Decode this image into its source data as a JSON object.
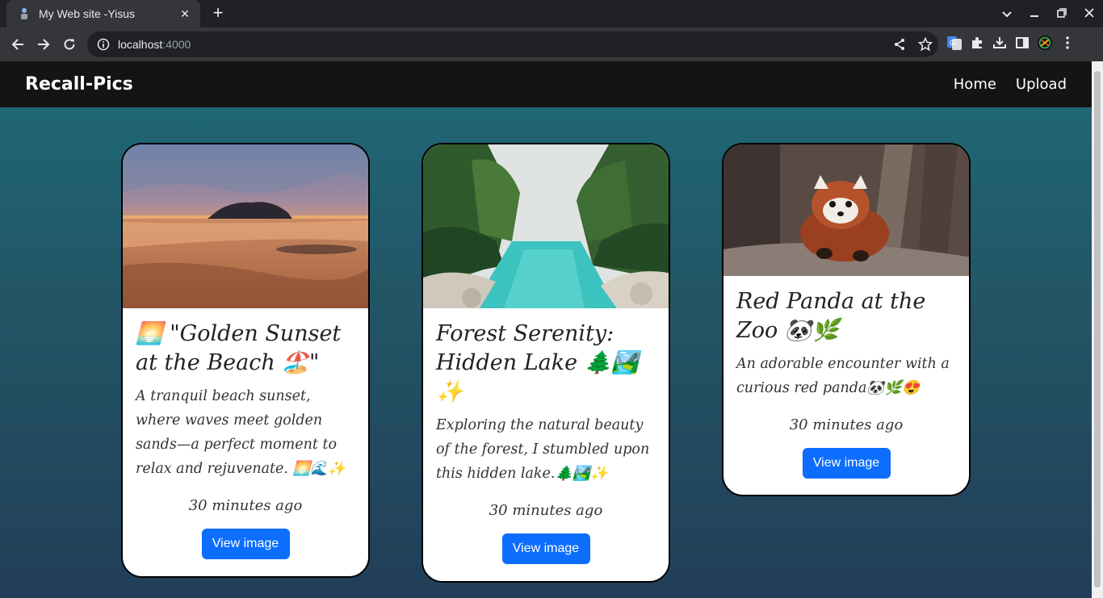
{
  "browser": {
    "tab_title": "My Web site -Yisus",
    "url_host": "localhost",
    "url_port": ":4000"
  },
  "site": {
    "brand": "Recall-Pics",
    "nav": [
      "Home",
      "Upload"
    ]
  },
  "cards": [
    {
      "title": "🌅 \"Golden Sunset at the Beach 🏖️\"",
      "description": "A tranquil beach sunset, where waves meet golden sands—a perfect moment to relax and rejuvenate. 🌅🌊✨",
      "time": "30 minutes ago",
      "button": "View image"
    },
    {
      "title": "Forest Serenity: Hidden Lake 🌲🏞️✨",
      "description": "Exploring the natural beauty of the forest, I stumbled upon this hidden lake.🌲🏞️✨",
      "time": "30 minutes ago",
      "button": "View image"
    },
    {
      "title": "Red Panda at the Zoo 🐼🌿",
      "description": "An adorable encounter with a curious red panda🐼🌿😍",
      "time": "30 minutes ago",
      "button": "View image"
    }
  ]
}
